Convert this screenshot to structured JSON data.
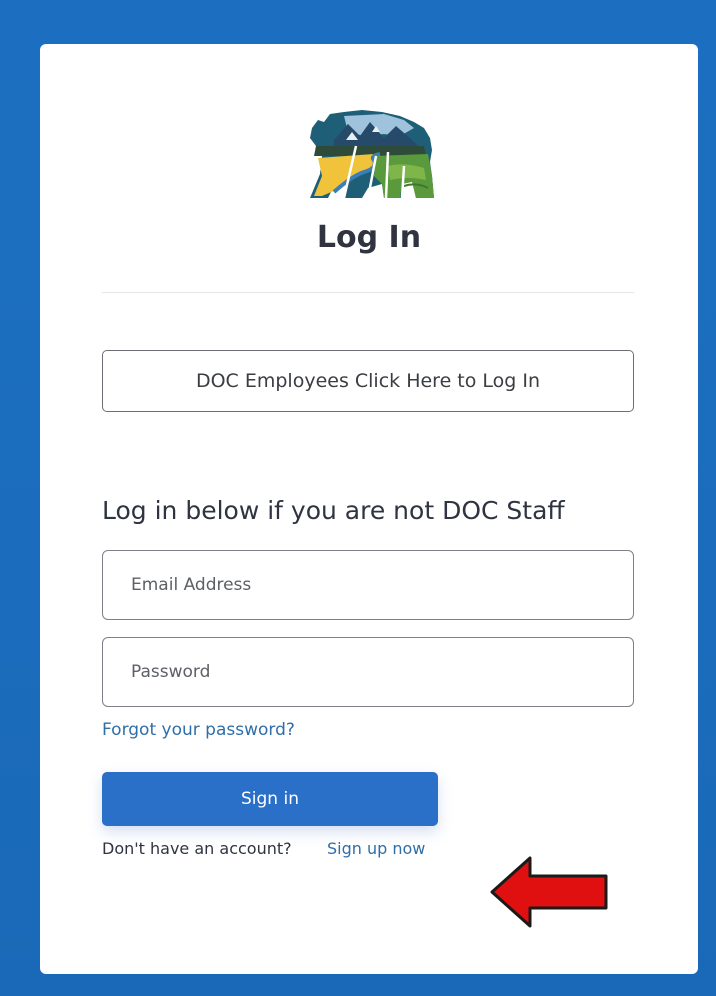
{
  "page": {
    "title": "Log In",
    "doc_button_label": "DOC Employees Click Here to Log In",
    "subheading": "Log in below if you are not DOC Staff"
  },
  "form": {
    "email_placeholder": "Email Address",
    "email_value": "",
    "password_placeholder": "Password",
    "password_value": "",
    "forgot_link": "Forgot your password?",
    "signin_label": "Sign in",
    "no_account_text": "Don't have an account?",
    "signup_link": "Sign up now"
  },
  "icons": {
    "logo": "bear-landscape-logo",
    "annotation": "red-arrow-icon"
  },
  "colors": {
    "background": "#1d70c0",
    "primary_button": "#2a6fc8",
    "link": "#2f6ea8",
    "arrow": "#e01010"
  }
}
